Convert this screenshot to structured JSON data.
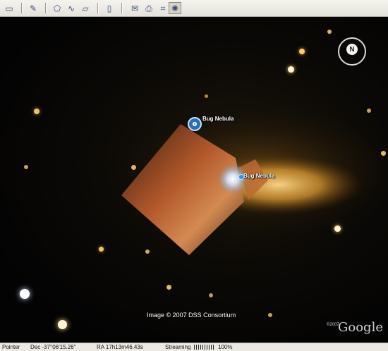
{
  "toolbar": {
    "buttons": [
      {
        "name": "sidebar-toggle-button",
        "icon": "sidebar-icon"
      },
      {
        "name": "add-placemark-button",
        "icon": "placemark-icon"
      },
      {
        "name": "add-polygon-button",
        "icon": "polygon-icon"
      },
      {
        "name": "add-path-button",
        "icon": "path-icon"
      },
      {
        "name": "add-image-overlay-button",
        "icon": "image-overlay-icon"
      },
      {
        "name": "record-tour-button",
        "icon": "ruler-icon"
      },
      {
        "name": "email-button",
        "icon": "email-icon"
      },
      {
        "name": "print-button",
        "icon": "print-icon"
      },
      {
        "name": "view-in-maps-button",
        "icon": "map-icon"
      },
      {
        "name": "sky-mode-button",
        "icon": "sky-icon"
      }
    ]
  },
  "view": {
    "placemarks": [
      {
        "label": "Bug Nebula"
      },
      {
        "label": "Bug Nebula"
      }
    ],
    "attribution": "Image © 2007 DSS Consortium",
    "compass_label": "N",
    "logo_copyright": "©2007",
    "logo_text": "Google"
  },
  "status": {
    "mode": "Pointer",
    "dec": "Dec -37°06'15.26\"",
    "ra": "RA  17h13m46.43s",
    "streaming_label": "Streaming",
    "streaming_percent": "100%",
    "streaming_progress": 1.0
  }
}
